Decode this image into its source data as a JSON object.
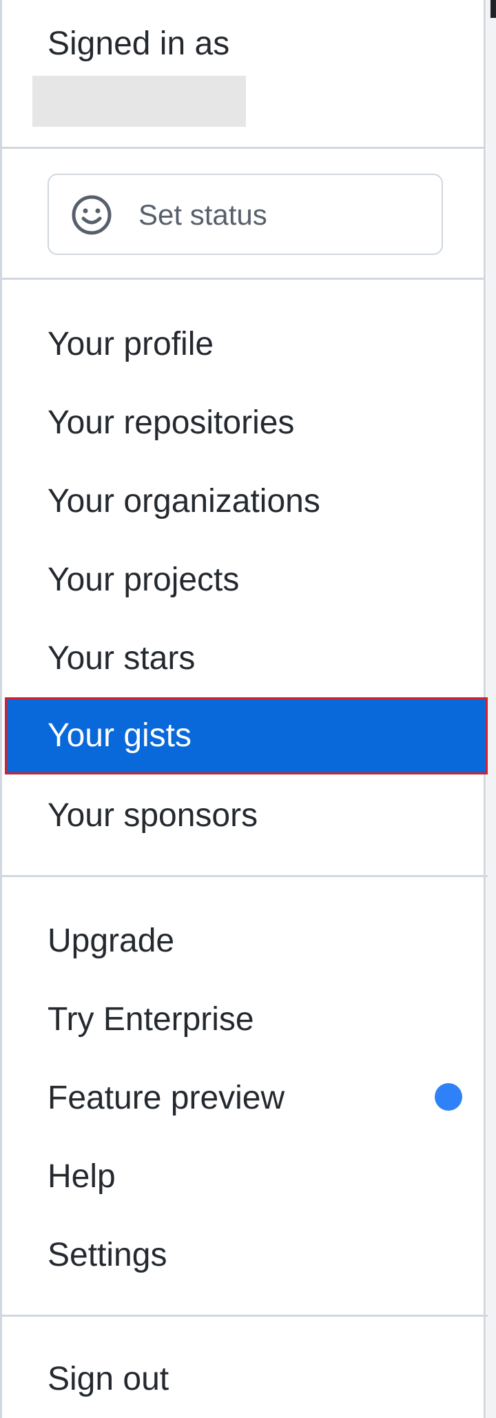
{
  "header": {
    "signed_in_label": "Signed in as"
  },
  "status": {
    "label": "Set status",
    "icon": "smiley-icon"
  },
  "menu": {
    "profile": "Your profile",
    "repositories": "Your repositories",
    "organizations": "Your organizations",
    "projects": "Your projects",
    "stars": "Your stars",
    "gists": "Your gists",
    "sponsors": "Your sponsors",
    "upgrade": "Upgrade",
    "try_enterprise": "Try Enterprise",
    "feature_preview": "Feature preview",
    "help": "Help",
    "settings": "Settings",
    "sign_out": "Sign out"
  },
  "colors": {
    "active_bg": "#0969da",
    "highlight_border": "#cf222e",
    "dot": "#2f81f7",
    "divider": "#d0d7de"
  }
}
